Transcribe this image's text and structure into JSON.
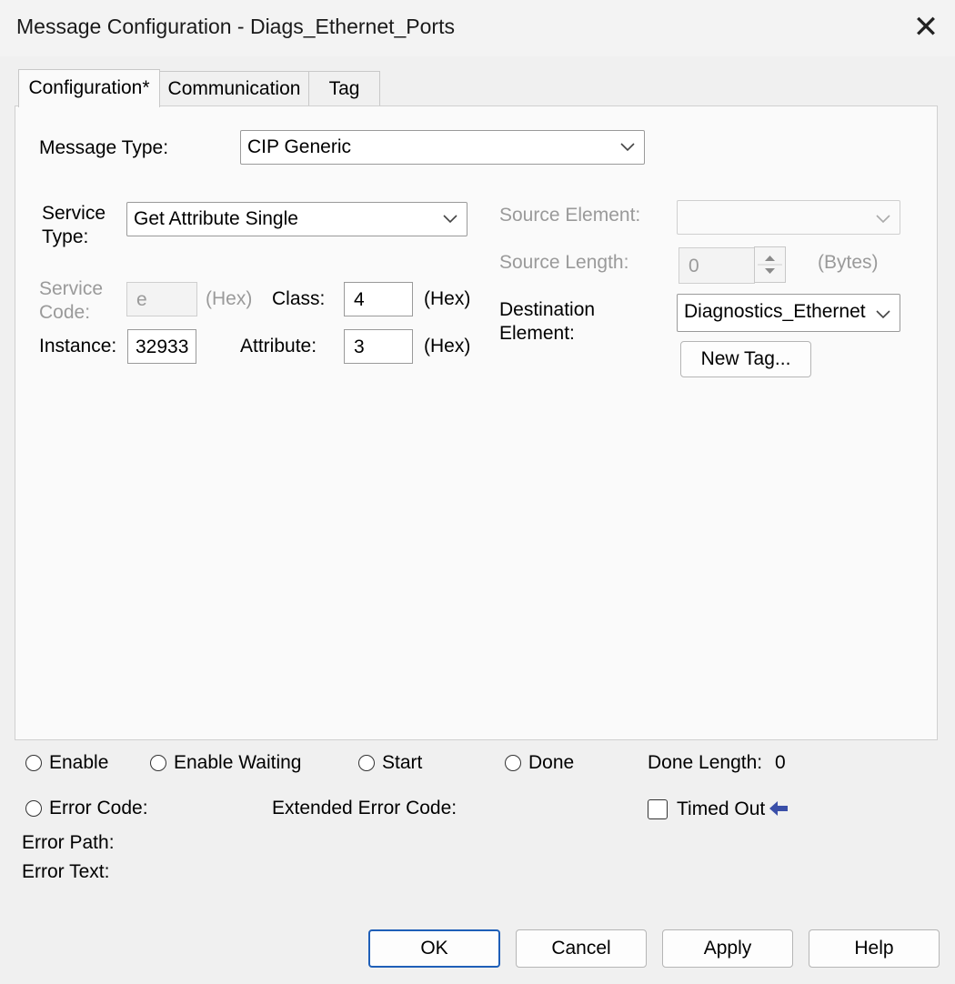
{
  "window": {
    "title": "Message Configuration - Diags_Ethernet_Ports",
    "close_glyph": "✕"
  },
  "tabs": [
    {
      "label": "Configuration*"
    },
    {
      "label": "Communication"
    },
    {
      "label": "Tag"
    }
  ],
  "config": {
    "message_type_label": "Message Type:",
    "message_type_value": "CIP Generic",
    "service_type_label_1": "Service",
    "service_type_label_2": "Type:",
    "service_type_value": "Get Attribute Single",
    "service_code_label_1": "Service",
    "service_code_label_2": "Code:",
    "service_code_value": "e",
    "hex_label": "(Hex)",
    "class_label": "Class:",
    "class_value": "4",
    "instance_label": "Instance:",
    "instance_value": "32933",
    "attribute_label": "Attribute:",
    "attribute_value": "3",
    "source_element_label": "Source Element:",
    "source_element_value": "",
    "source_length_label": "Source Length:",
    "source_length_value": "0",
    "bytes_label": "(Bytes)",
    "destination_label_1": "Destination",
    "destination_label_2": "Element:",
    "destination_value": "Diagnostics_Ethernet",
    "new_tag_label": "New Tag..."
  },
  "status": {
    "enable": "Enable",
    "enable_waiting": "Enable Waiting",
    "start": "Start",
    "done": "Done",
    "done_length_label": "Done Length:",
    "done_length_value": "0",
    "error_code_label": "Error Code:",
    "extended_error_label": "Extended Error Code:",
    "timed_out_label": "Timed Out",
    "error_path_label": "Error Path:",
    "error_text_label": "Error Text:"
  },
  "buttons": {
    "ok": "OK",
    "cancel": "Cancel",
    "apply": "Apply",
    "help": "Help"
  },
  "colors": {
    "accent": "#1f5fb8",
    "arrow": "#3a4fa8",
    "disabled_text": "#9a9a9a"
  },
  "icons": {
    "close": "close-icon",
    "chevron": "chevron-down-icon",
    "arrow": "left-arrow-icon"
  }
}
